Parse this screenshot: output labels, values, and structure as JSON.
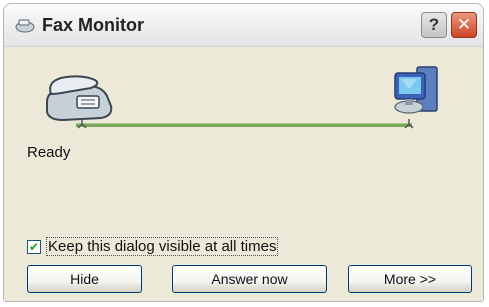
{
  "window": {
    "title": "Fax Monitor",
    "help_label": "?",
    "close_label": "✕"
  },
  "status": {
    "text": "Ready"
  },
  "options": {
    "keep_visible_label": "Keep this dialog visible at all times",
    "keep_visible_checked": true,
    "check_mark": "✔"
  },
  "buttons": {
    "hide_label": "Hide",
    "answer_label": "Answer now",
    "more_label": "More >>"
  },
  "icons": {
    "app": "fax-monitor-app-icon",
    "fax": "fax-machine-icon",
    "computer": "computer-icon",
    "help": "help-icon",
    "close": "close-icon"
  },
  "colors": {
    "connection_line": "#7ca65c",
    "close_button": "#cd4526",
    "checkbox_border": "#1c5180",
    "button_border": "#003c74"
  }
}
